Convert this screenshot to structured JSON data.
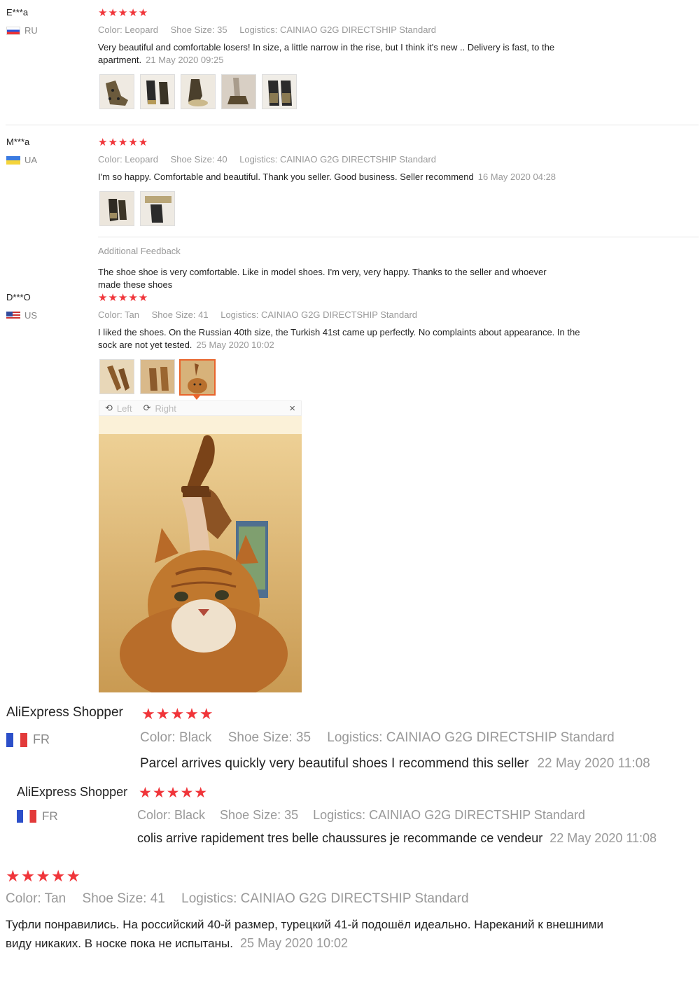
{
  "reviews": [
    {
      "user": "E***a",
      "country": "RU",
      "stars": "★★★★★",
      "color": "Color: Leopard",
      "size": "Shoe Size: 35",
      "logistics": "Logistics: CAINIAO G2G DIRECTSHIP Standard",
      "text_line1": "Very beautiful and comfortable losers! In size, a little narrow in the rise, but I think it's new .. Delivery is fast, to the",
      "text_line2": "apartment.",
      "date": "21 May 2020 09:25",
      "photo_count": 5
    },
    {
      "user": "M***a",
      "country": "UA",
      "stars": "★★★★★",
      "color": "Color: Leopard",
      "size": "Shoe Size: 40",
      "logistics": "Logistics: CAINIAO G2G DIRECTSHIP Standard",
      "text": "I'm so happy. Comfortable and beautiful. Thank you seller. Good business. Seller recommend",
      "date": "16 May 2020 04:28",
      "photo_count": 2,
      "additional_label": "Additional Feedback",
      "additional_line1": "The shoe shoe is very comfortable. Like in model shoes. I'm very, very happy. Thanks to the seller and whoever",
      "additional_line2": "made these shoes"
    },
    {
      "user": "D***O",
      "country": "US",
      "stars": "★★★★★",
      "color": "Color: Tan",
      "size": "Shoe Size: 41",
      "logistics": "Logistics: CAINIAO G2G DIRECTSHIP Standard",
      "text_line1": "I liked the shoes. On the Russian 40th size, the Turkish 41st came up perfectly. No complaints about appearance. In the",
      "text_line2": "sock are not yet tested.",
      "date": "25 May 2020 10:02",
      "photo_count": 3,
      "viewer": {
        "left": "Left",
        "right": "Right",
        "close": "×"
      }
    },
    {
      "user": "AliExpress Shopper",
      "country": "FR",
      "stars": "★★★★★",
      "color": "Color: Black",
      "size": "Shoe Size: 35",
      "logistics": "Logistics: CAINIAO G2G DIRECTSHIP Standard",
      "text": "Parcel arrives quickly very beautiful shoes I recommend this seller",
      "date": "22 May 2020 11:08"
    },
    {
      "user": "AliExpress Shopper",
      "country": "FR",
      "stars": "★★★★★",
      "color": "Color: Black",
      "size": "Shoe Size: 35",
      "logistics": "Logistics: CAINIAO G2G DIRECTSHIP Standard",
      "text": "colis arrive rapidement tres belle chaussures je recommande ce vendeur",
      "date": "22 May 2020 11:08"
    },
    {
      "stars": "★★★★★",
      "color": "Color: Tan",
      "size": "Shoe Size: 41",
      "logistics": "Logistics: CAINIAO G2G DIRECTSHIP Standard",
      "text_line1": "Туфли понравились. На российский 40-й размер, турецкий 41-й подошёл идеально. Нареканий к внешними",
      "text_line2": "виду никаких. В носке пока не испытаны.",
      "date": "25 May 2020 10:02"
    }
  ],
  "colors": {
    "star": "#f0353a",
    "meta": "#999999",
    "selected_thumb": "#e8642c"
  }
}
